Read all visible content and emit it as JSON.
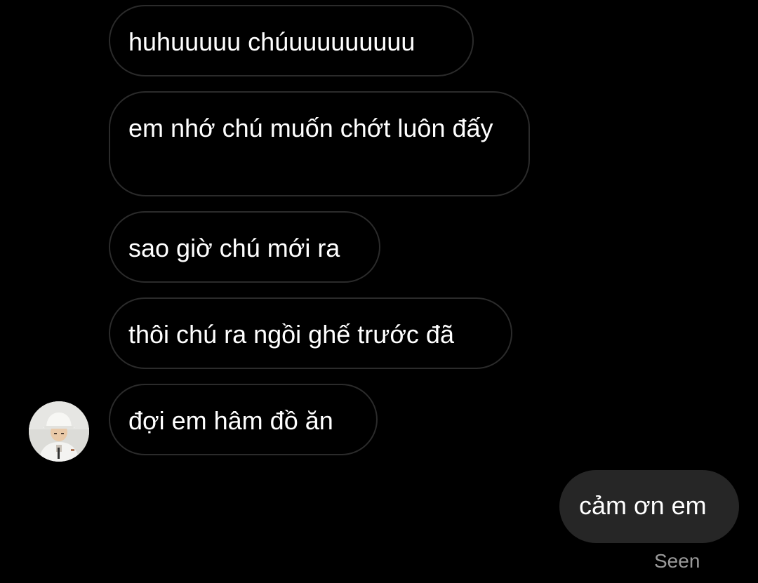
{
  "conversation": {
    "messages": [
      {
        "direction": "incoming",
        "text": "huhuuuuu chúuuuuuuuuu"
      },
      {
        "direction": "incoming",
        "text": "em nhớ chú muốn chớt luôn đấy"
      },
      {
        "direction": "incoming",
        "text": "sao giờ chú mới ra"
      },
      {
        "direction": "incoming",
        "text": "thôi chú ra ngồi ghế trước đã"
      },
      {
        "direction": "incoming",
        "text": "đợi em hâm đồ ăn"
      },
      {
        "direction": "outgoing",
        "text": "cảm ơn em"
      }
    ],
    "read_receipt": "Seen"
  },
  "colors": {
    "background": "#000000",
    "incoming_border": "#2b2b2b",
    "outgoing_bubble": "#262626",
    "text": "#ffffff",
    "receipt_text": "#9a9a9a"
  }
}
